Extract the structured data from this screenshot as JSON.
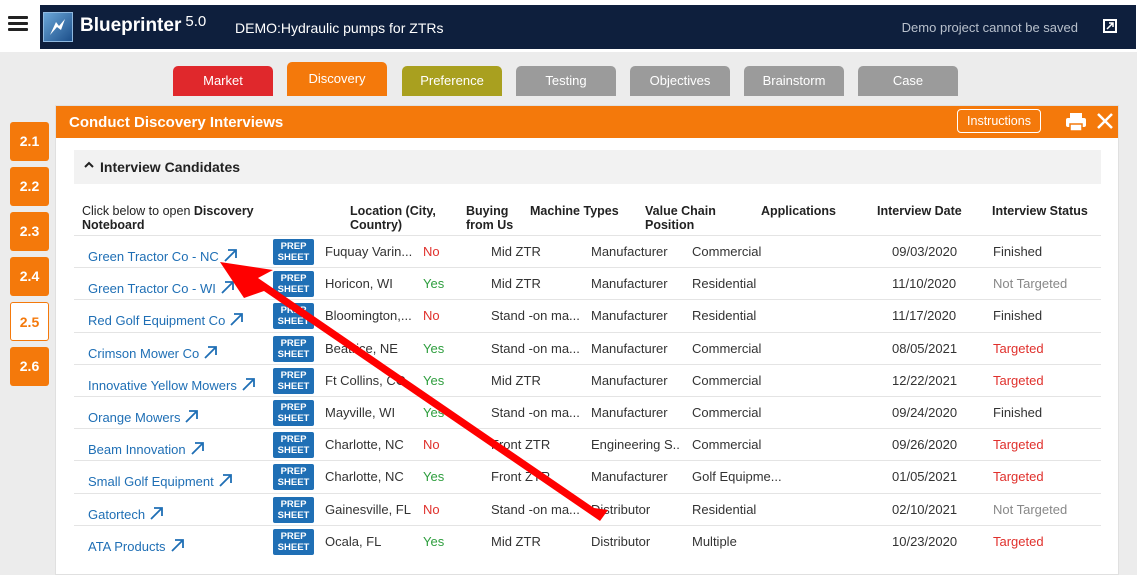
{
  "app": {
    "name": "Blueprinter",
    "version": "5.0",
    "project": "DEMO:Hydraulic pumps for ZTRs",
    "demo_note": "Demo project cannot be saved"
  },
  "tabs": [
    {
      "label": "Market",
      "color": "#e0282c"
    },
    {
      "label": "Discovery",
      "color": "#f4790b",
      "active": true
    },
    {
      "label": "Preference",
      "color": "#a9a01f"
    },
    {
      "label": "Testing",
      "color": "#9b9b9b"
    },
    {
      "label": "Objectives",
      "color": "#9b9b9b"
    },
    {
      "label": "Brainstorm",
      "color": "#9b9b9b"
    },
    {
      "label": "Case",
      "color": "#9b9b9b"
    }
  ],
  "side_steps": [
    "2.1",
    "2.2",
    "2.3",
    "2.4",
    "2.5",
    "2.6"
  ],
  "active_step": "2.5",
  "panel": {
    "title": "Conduct Discovery Interviews",
    "instructions_label": "Instructions"
  },
  "section": {
    "title": "Interview Candidates"
  },
  "columns": {
    "name_prefix": "Click below to open ",
    "name_bold1": "Discovery",
    "name_bold2": "Noteboard",
    "location1": "Location (City,",
    "location2": "Country)",
    "buying1": "Buying",
    "buying2": "from Us",
    "machine": "Machine Types",
    "chain1": "Value Chain",
    "chain2": "Position",
    "applications": "Applications",
    "date": "Interview Date",
    "status": "Interview Status"
  },
  "prep_label1": "PREP",
  "prep_label2": "SHEET",
  "rows": [
    {
      "name": "Green Tractor Co - NC",
      "location": "Fuquay Varin...",
      "buying": "No",
      "machine": "Mid ZTR",
      "chain": "Manufacturer",
      "app": "Commercial",
      "date": "09/03/2020",
      "status": "Finished"
    },
    {
      "name": "Green Tractor Co - WI",
      "location": "Horicon, WI",
      "buying": "Yes",
      "machine": "Mid ZTR",
      "chain": "Manufacturer",
      "app": "Residential",
      "date": "11/10/2020",
      "status": "Not Targeted"
    },
    {
      "name": "Red Golf Equipment Co",
      "location": "Bloomington,...",
      "buying": "No",
      "machine": "Stand -on ma...",
      "chain": "Manufacturer",
      "app": "Residential",
      "date": "11/17/2020",
      "status": "Finished"
    },
    {
      "name": "Crimson Mower Co",
      "location": "Beatrice, NE",
      "buying": "Yes",
      "machine": "Stand -on ma...",
      "chain": "Manufacturer",
      "app": "Commercial",
      "date": "08/05/2021",
      "status": "Targeted"
    },
    {
      "name": "Innovative Yellow Mowers",
      "location": "Ft Collins, CO",
      "buying": "Yes",
      "machine": "Mid ZTR",
      "chain": "Manufacturer",
      "app": "Commercial",
      "date": "12/22/2021",
      "status": "Targeted"
    },
    {
      "name": "Orange Mowers",
      "location": "Mayville, WI",
      "buying": "Yes",
      "machine": "Stand -on ma...",
      "chain": "Manufacturer",
      "app": "Commercial",
      "date": "09/24/2020",
      "status": "Finished"
    },
    {
      "name": "Beam Innovation",
      "location": "Charlotte, NC",
      "buying": "No",
      "machine": "Front ZTR",
      "chain": "Engineering S...",
      "app": "Commercial",
      "date": "09/26/2020",
      "status": "Targeted"
    },
    {
      "name": "Small Golf Equipment",
      "location": "Charlotte, NC",
      "buying": "Yes",
      "machine": "Front ZTR",
      "chain": "Manufacturer",
      "app": "Golf Equipme...",
      "date": "01/05/2021",
      "status": "Targeted"
    },
    {
      "name": "Gatortech",
      "location": "Gainesville, FL",
      "buying": "No",
      "machine": "Stand -on ma...",
      "chain": "Distributor",
      "app": "Residential",
      "date": "02/10/2021",
      "status": "Not Targeted"
    },
    {
      "name": "ATA Products",
      "location": "Ocala, FL",
      "buying": "Yes",
      "machine": "Mid ZTR",
      "chain": "Distributor",
      "app": "Multiple",
      "date": "10/23/2020",
      "status": "Targeted"
    }
  ],
  "colors": {
    "accent": "#f4790b",
    "navy": "#0e1f3d",
    "link": "#1f6fb5",
    "yes": "#2e9e3e",
    "no": "#e0302c",
    "arrow": "#ff0000"
  }
}
